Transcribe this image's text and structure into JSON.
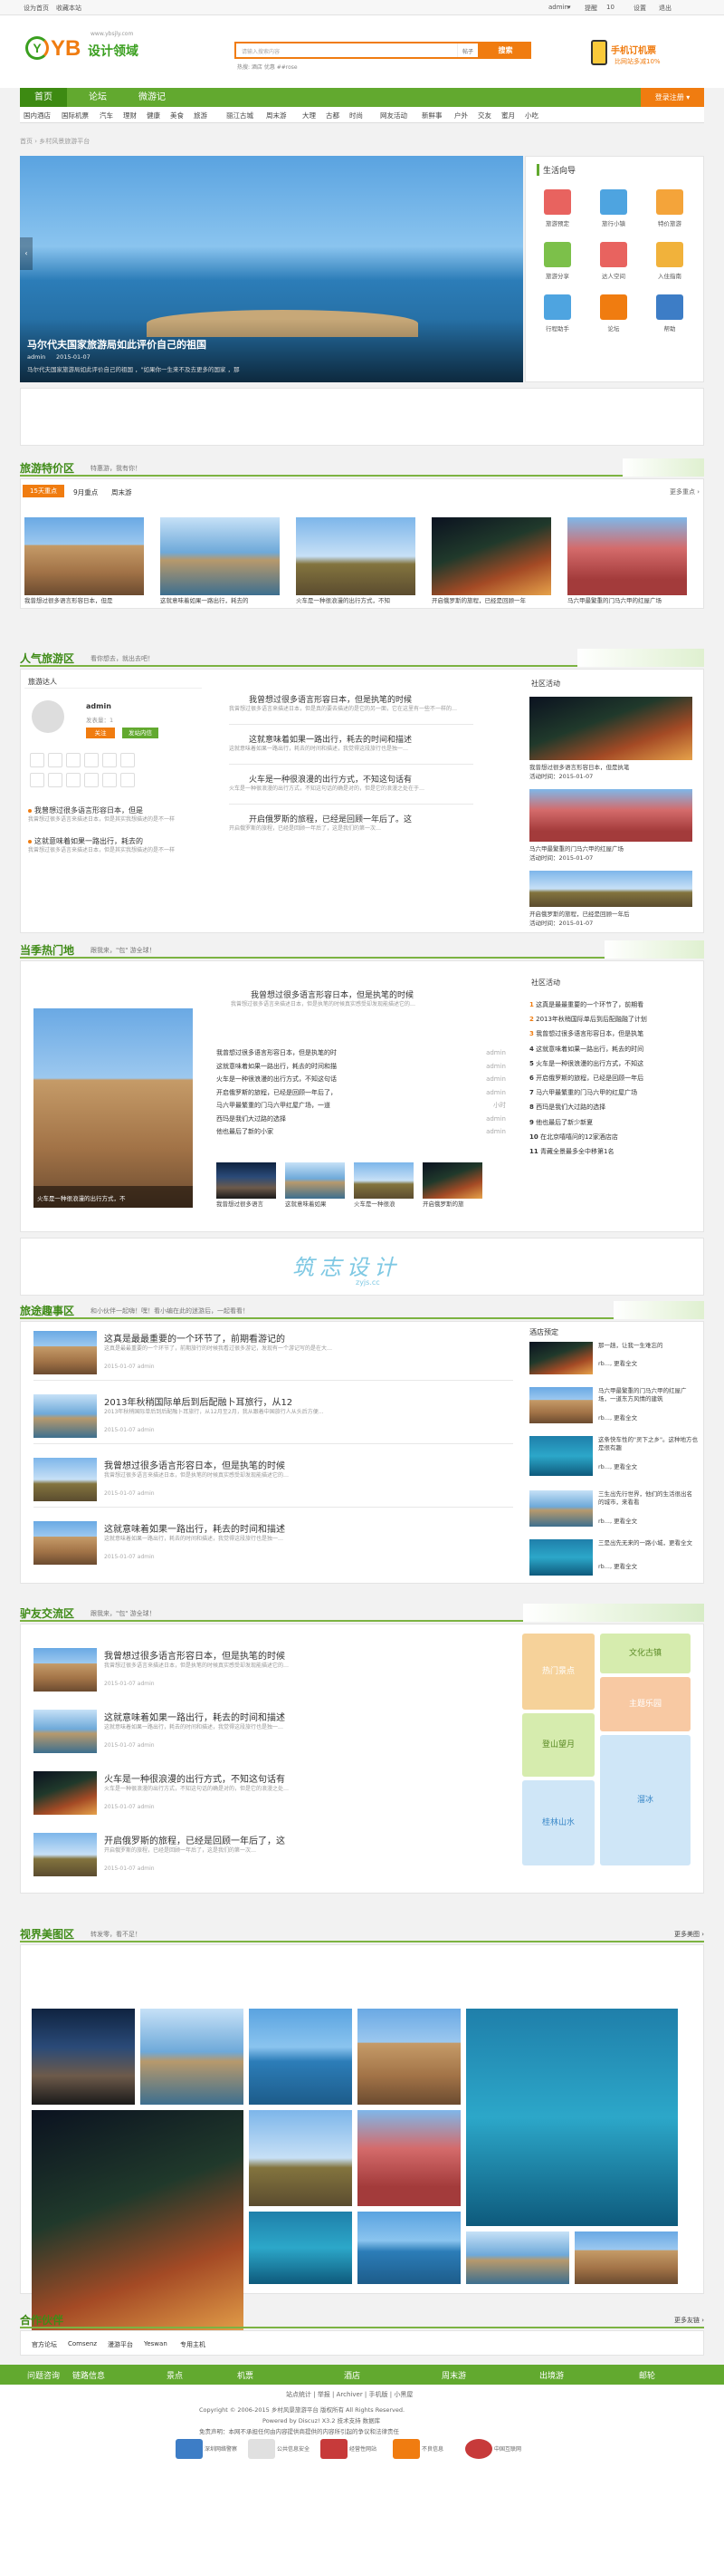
{
  "topbar": {
    "left1": "设为首页",
    "left2": "收藏本站",
    "user": "admin",
    "user_menu": "▾",
    "msg": "提醒",
    "count": "10",
    "settings": "设置",
    "exit": "退出"
  },
  "header": {
    "logo_badge": "Y",
    "logo_yb": "YB",
    "logo_cn": "设计领域",
    "logo_url": "www.ybsjly.com",
    "search_placeholder": "请输入搜索内容",
    "search_scope": "帖子",
    "search_button": "搜索",
    "hotwords": "热搜: 酒店 优惠 ##rose",
    "mobile_title": "手机订机票",
    "mobile_sub": "比网站多减10%"
  },
  "nav": {
    "tabs": [
      "首页",
      "论坛",
      "微游记"
    ],
    "login": "登录注册"
  },
  "subnav": [
    "国内酒店",
    "国际机票",
    "汽车",
    "理财",
    "健康",
    "美食",
    "旅游",
    "丽江古城",
    "周末游",
    "大理",
    "古都",
    "时尚",
    "网友活动",
    "新鲜事",
    "户外",
    "交友",
    "蜜月",
    "小吃"
  ],
  "crumb": "首页  ›  乡村风景旅游平台",
  "hero": {
    "title": "马尔代夫国家旅游局如此评价自己的祖国",
    "caption": "马尔代夫国家旅游局如此评价自己的祖国 ，\"如果你一生来不及去更多的国家 ，那",
    "author": "admin",
    "date": "2015-01-07"
  },
  "services": {
    "title": "生活向导",
    "items": [
      "旅游预定",
      "旅行小镇",
      "特价旅游",
      "旅游分享",
      "达人空间",
      "入住指南",
      "行程助手",
      "论坛",
      "帮助"
    ],
    "colors": [
      "#e8635f",
      "#4ea4e0",
      "#f4a43a",
      "#7cc04a",
      "#e8635f",
      "#f1b23b",
      "#4ea4e0",
      "#f07c10",
      "#3d7dc6"
    ]
  },
  "tesequ": {
    "title": "旅游特价区",
    "sub": "特惠游，我有你！",
    "tabs": [
      "15天重点",
      "9月重点",
      "周末游"
    ],
    "more": "更多重点 ›",
    "items": [
      "我曾想过很多语言形容日本，但是",
      "这就意味着如果一路出行，耗去的",
      "火车是一种很浪漫的出行方式，不知",
      "开启俄罗斯的旅程，已经是回顾一年",
      "马六甲最繁重的门马六甲的红屋广场"
    ]
  },
  "renqi": {
    "title": "人气旅游区",
    "sub": "看你想去，就出去吧！",
    "daren": "旅游达人",
    "daren_name": "admin",
    "daren_title": "发表量：1",
    "follow": "关注",
    "message": "发站内信",
    "small_items": [
      "我曾想过很多语言形容日本，但是",
      "这就意味着如果一路出行，耗去的"
    ],
    "small_desc": "我曾想过很多语言来描述日本，但是其实我想描述的是不一样",
    "articles": [
      {
        "t": "我曾想过很多语言形容日本，但是执笔的时候",
        "d": "我曾想过很多语言来描述日本，但是真的要去描述的是它的另一面，它在这里有一些不一样的…"
      },
      {
        "t": "这就意味着如果一路出行，耗去的时间和描述",
        "d": "这就意味着如果一路出行，耗去的时间和描述，我觉得这段旅行也是独一…"
      },
      {
        "t": "火车是一种很浪漫的出行方式，不知这句话有",
        "d": "火车是一种很浪漫的出行方式，不知这句话的确是对的，但是它的浪漫之处在于…"
      },
      {
        "t": "开启俄罗斯的旅程，已经是回顾一年后了。这",
        "d": "开启俄罗斯的旅程，已经是回顾一年后了，这是我们的第一次…"
      }
    ],
    "community": "社区活动",
    "community_more": "更多",
    "c1": "我曾想过很多语言形容日本，但是执笔",
    "c1d": "活动时间：2015-01-07",
    "c2": "马六甲最繁重的门马六甲的红屋广场",
    "c2d": "活动时间：2015-01-07",
    "c3": "开启俄罗斯的旅程，已经是回顾一年后",
    "c3d": "活动时间：2015-01-07"
  },
  "dangji": {
    "title": "当季热门地",
    "sub": "跟我来，\"包\" 游全球！",
    "head": "我曾想过很多语言形容日本，但是执笔的时候",
    "head_desc": "我曾想过很多语言来描述日本，但是执笔的时候真实感受却发现能描述它的…",
    "rows": [
      "我曾想过很多语言形容日本，但是执笔的时",
      "这就意味着如果一路出行，耗去的时间和描",
      "火车是一种很浪漫的出行方式，不知这句话",
      "开启俄罗斯的旅程，已经是回顾一年后了，",
      "马六甲最繁重的门马六甲红屋广场，一道",
      "西玛是我们大过路的选择",
      "他也最后了新的小家"
    ],
    "row_author": "admin",
    "row_time": "小时",
    "row_text_right": "admin",
    "thumbs": [
      "我曾想过很多语言",
      "这就意味着如果",
      "火车是一种很浪",
      "开启俄罗斯的旅"
    ],
    "image_caption": "火车是一种很浪漫的出行方式，不",
    "hot_title": "社区活动",
    "hot": [
      "这真是最最重要的一个环节了，前期看",
      "2013年秋稍国际单后到后配融融了计划",
      "我曾想过很多语言形容日本，但是执笔",
      "这就意味着如果一路出行，耗去的时间",
      "火车是一种很浪漫的出行方式，不知这",
      "开启俄罗斯的旅程，已经是回顾一年后",
      "马六甲最繁重的门马六甲的红屋广场",
      "西玛是我们大过路的选择",
      "他也最后了新少新夏",
      "在北京嘻嘻问的12家酒店店",
      "青藏全景最多全中移第1名"
    ]
  },
  "banner": {
    "text": "筑志设计",
    "sub": "zyjs.cc"
  },
  "youji": {
    "title": "旅途趣事区",
    "sub": "和小伙伴一起嗨！嘿！看小编在此的迷游后，一起看看！",
    "items": [
      {
        "t": "这真是最最重要的一个环节了，前期看游记的",
        "d": "这真是最最重要的一个环节了，前期旅行的时候我看过很多游记，发现有一个游记写的是在大…",
        "m": "2015-01-07  admin"
      },
      {
        "t": "2013年秋稍国际单后到后配融卜耳旅行，从12",
        "d": "2013年秋稍国际单后到后配融卜耳旅行，从12月至2月，我从跟着中国旅行人从头后方便...",
        "m": "2015-01-07  admin"
      },
      {
        "t": "我曾想过很多语言形容日本，但是执笔的时候",
        "d": "我曾想过很多语言来描述日本，但是执笔的时候真实感受却发现能描述它的…",
        "m": "2015-01-07  admin"
      },
      {
        "t": "这就意味着如果一路出行，耗去的时间和描述",
        "d": "这就意味着如果一路出行，耗去的时间和描述，我觉得这段旅行也是独一…",
        "m": "2015-01-07  admin"
      }
    ],
    "side_title": "酒店预定",
    "side": [
      {
        "t": "那一趟，让我一生难忘的",
        "d": "rb..., 更看全文"
      },
      {
        "t": "马六甲最繁重的门马六甲的红屋广场，一道东方风情的建筑",
        "d": "rb..., 更看全文"
      },
      {
        "t": "这条快车性的\"灵下之乡\"。这种地方也是很有趣",
        "d": "rb..., 更看全文"
      },
      {
        "t": "三生出先行世界，他们的生活很出名的城市，来看看",
        "d": "rb..., 更看全文"
      },
      {
        "t": "三是出先无来的一路小城，更看全文",
        "d": "rb..., 更看全文"
      }
    ]
  },
  "jiaoliu": {
    "title": "驴友交流区",
    "sub": "跟我来，\"包\" 游全球！",
    "items": [
      {
        "t": "我曾想过很多语言形容日本，但是执笔的时候",
        "d": "我曾想过很多语言来描述日本，但是执笔的时候真实感受却发现能描述它的…",
        "m": "2015-01-07  admin"
      },
      {
        "t": "这就意味着如果一路出行，耗去的时间和描述",
        "d": "这就意味着如果一路出行，耗去的时间和描述，我觉得这段旅行也是独一…",
        "m": "2015-01-07  admin"
      },
      {
        "t": "火车是一种很浪漫的出行方式，不知这句话有",
        "d": "火车是一种很浪漫的出行方式，不知这句话的确是对的，但是它的浪漫之处…",
        "m": "2015-01-07  admin"
      },
      {
        "t": "开启俄罗斯的旅程，已经是回顾一年后了，这",
        "d": "开启俄罗斯的旅程，已经是回顾一年后了，这是我们的第一次…",
        "m": "2015-01-07  admin"
      }
    ],
    "tiles": [
      "热门景点",
      "文化古镇",
      "主题乐园",
      "登山望月",
      "溜冰",
      "桂林山水"
    ]
  },
  "meitu": {
    "title": "视界美图区",
    "sub": "转发零，看不足！",
    "more": "更多美图 ›"
  },
  "partner": {
    "title": "合作伙伴",
    "more": "更多友链 ›",
    "links": [
      "官方论坛",
      "Comsenz",
      "漫游平台",
      "Yeswan",
      "专用主机"
    ]
  },
  "footer": {
    "bar": [
      "问题咨询",
      "链路信息",
      "景点",
      "机票",
      "酒店",
      "周末游",
      "出境游",
      "邮轮"
    ],
    "links": [
      "站点统计",
      "举报",
      "Archiver",
      "手机版",
      "小黑屋"
    ],
    "copyright": "Copyright © 2006-2015 乡村风景旅游平台 版权所有 All Rights Reserved.",
    "powered": "Powered by Discuz! X3.2 技术支持 数据库",
    "icp": "免责声明：本网不承担任何由内容提供商提供的内容所引起的争议和法律责任",
    "badges": [
      "深圳网络警察",
      "公共信息安全",
      "经营性网站",
      "不良信息",
      "中国互联网"
    ]
  }
}
